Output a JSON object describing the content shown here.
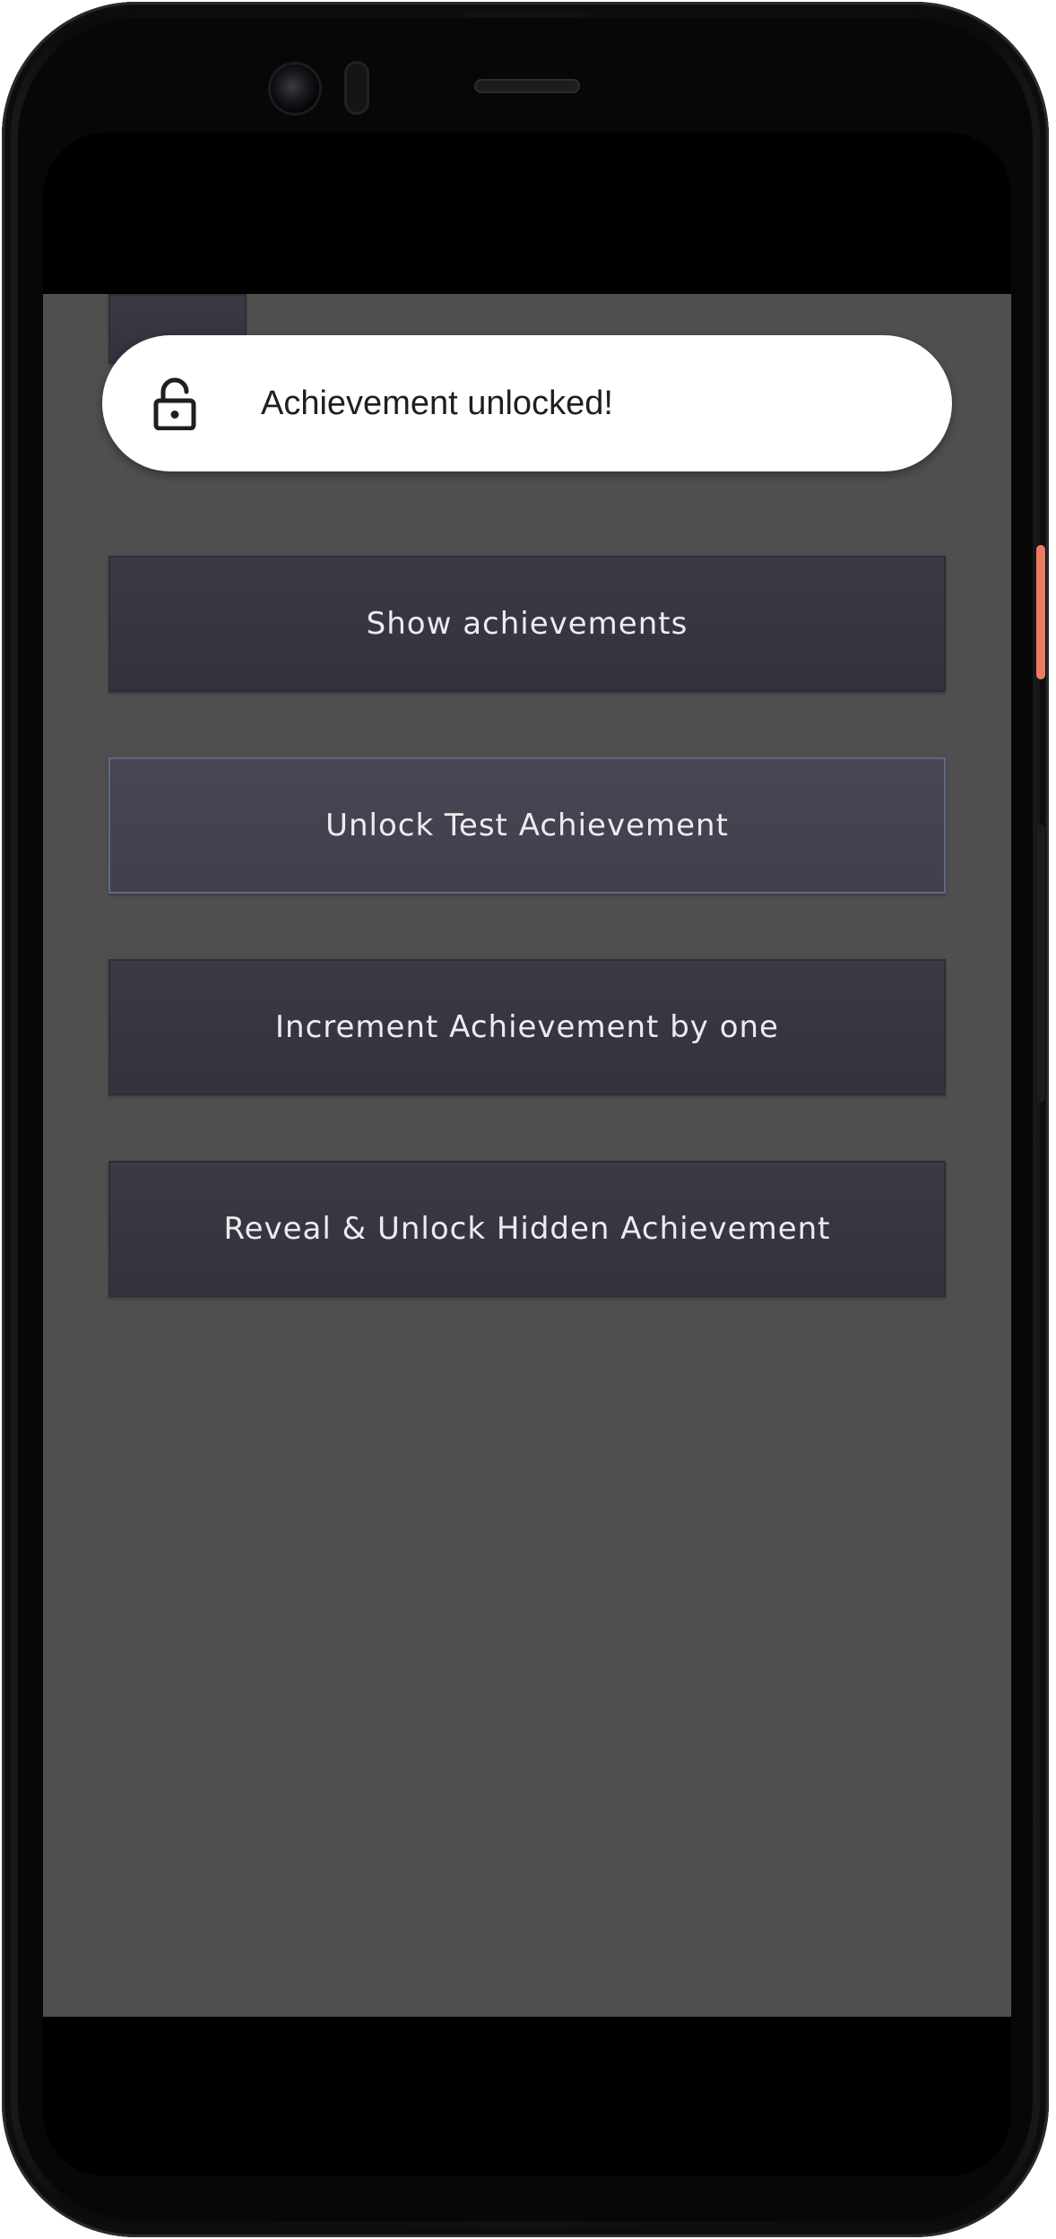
{
  "toast": {
    "icon": "lock-open-icon",
    "message": "Achievement unlocked!"
  },
  "buttons": {
    "show_achievements": "Show achievements",
    "unlock_test": "Unlock Test Achievement",
    "increment_by_one": "Increment Achievement by one",
    "reveal_unlock_hidden": "Reveal & Unlock Hidden Achievement"
  },
  "colors": {
    "app_background": "#4f4f4f",
    "button_background": "#3b3a45",
    "button_focused_border": "#5b6a86",
    "toast_background": "#ffffff",
    "power_button_accent": "#f07c64"
  }
}
